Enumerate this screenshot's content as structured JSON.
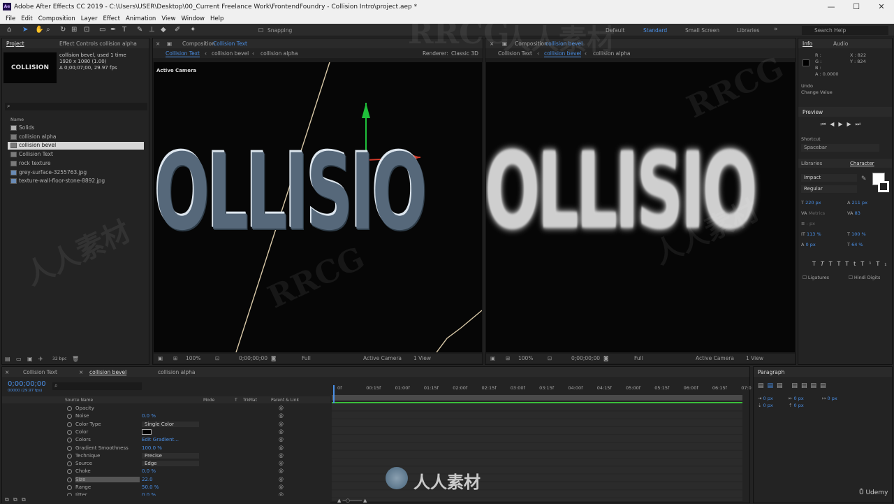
{
  "app": {
    "title": "Adobe After Effects CC 2019 - C:\\Users\\USER\\Desktop\\00_Current Freelance Work\\FrontendFoundry - Collision Intro\\project.aep *",
    "icon": "Ae"
  },
  "menu": [
    "File",
    "Edit",
    "Composition",
    "Layer",
    "Effect",
    "Animation",
    "View",
    "Window",
    "Help"
  ],
  "toolbar": {
    "snapping": "Snapping",
    "workspaces": [
      "Default",
      "Standard",
      "Small Screen",
      "Libraries"
    ],
    "search_placeholder": "Search Help"
  },
  "project": {
    "tab": "Project",
    "effect_tab": "Effect Controls collision alpha",
    "thumb_label": "COLLISION",
    "item_name": "collision bevel",
    "used": ", used 1 time",
    "dims": "1920 x 1080 (1.00)",
    "duration": "Δ 0;00;07;00, 29.97 fps",
    "col_name": "Name",
    "items": [
      {
        "name": "Solids",
        "type": "folder"
      },
      {
        "name": "collision alpha",
        "type": "comp"
      },
      {
        "name": "collision bevel",
        "type": "comp",
        "selected": true
      },
      {
        "name": "Collision Text",
        "type": "comp"
      },
      {
        "name": "rock texture",
        "type": "comp"
      },
      {
        "name": "grey-surface-3255763.jpg",
        "type": "image"
      },
      {
        "name": "texture-wall-floor-stone-8892.jpg",
        "type": "image"
      }
    ],
    "bpc": "32 bpc"
  },
  "comp1": {
    "tab_prefix": "Composition",
    "tab_name": "Collision Text",
    "crumbs": [
      "Collision Text",
      "collision bevel",
      "collision alpha"
    ],
    "renderer_label": "Renderer:",
    "renderer": "Classic 3D",
    "camera_label": "Active Camera",
    "text": "OLLISIO",
    "zoom": "100%",
    "time": "0;00;00;00",
    "quality": "Full",
    "camera": "Active Camera",
    "views": "1 View"
  },
  "comp2": {
    "tab_prefix": "Composition",
    "tab_name": "collision bevel",
    "crumbs": [
      "Collision Text",
      "collision bevel",
      "collision alpha"
    ],
    "text": "OLLISIO",
    "zoom": "100%",
    "time": "0;00;00;00",
    "quality": "Full",
    "camera": "Active Camera",
    "views": "1 View"
  },
  "info": {
    "tab": "Info",
    "audio_tab": "Audio",
    "r": "R :",
    "g": "G :",
    "b": "B :",
    "a": "A : 0.0000",
    "x": "X : 822",
    "y": "Y : 824",
    "undo": "Undo",
    "undo_val": "Change Value"
  },
  "preview": {
    "tab": "Preview",
    "shortcut_label": "Shortcut",
    "shortcut": "Spacebar"
  },
  "character": {
    "libraries": "Libraries",
    "tab": "Character",
    "font": "Impact",
    "style": "Regular",
    "size": "220 px",
    "leading": "211 px",
    "kerning": "Metrics",
    "tracking": "83",
    "stroke": "- px",
    "vscale": "113 %",
    "hscale": "100 %",
    "baseline": "0 px",
    "tsume": "64 %",
    "ligatures": "Ligatures",
    "hindi": "Hindi Digits"
  },
  "timeline": {
    "tabs": [
      "Collision Text",
      "collision bevel",
      "collision alpha"
    ],
    "time": "0;00;00;00",
    "fps": "00000 (29.97 fps)",
    "headers": [
      "Source Name",
      "Mode",
      "T",
      "TrkMat",
      "Parent & Link"
    ],
    "ruler": [
      "0f",
      "00:15f",
      "01:00f",
      "01:15f",
      "02:00f",
      "02:15f",
      "03:00f",
      "03:15f",
      "04:00f",
      "04:15f",
      "05:00f",
      "05:15f",
      "06:00f",
      "06:15f",
      "07:0"
    ],
    "props": [
      {
        "name": "Opacity",
        "value": ""
      },
      {
        "name": "Noise",
        "value": "0.0 %"
      },
      {
        "name": "Color Type",
        "value": "Single Color",
        "dropdown": true
      },
      {
        "name": "Color",
        "value": ""
      },
      {
        "name": "Colors",
        "value": "Edit Gradient..."
      },
      {
        "name": "Gradient Smoothness",
        "value": "100.0 %"
      },
      {
        "name": "Technique",
        "value": "Precise",
        "dropdown": true
      },
      {
        "name": "Source",
        "value": "Edge",
        "dropdown": true
      },
      {
        "name": "Choke",
        "value": "0.0 %"
      },
      {
        "name": "Size",
        "value": "22.0",
        "selected": true
      },
      {
        "name": "Range",
        "value": "50.0 %"
      },
      {
        "name": "Jitter",
        "value": "0.0 %"
      }
    ]
  },
  "paragraph": {
    "tab": "Paragraph",
    "indent1": "0 px",
    "indent2": "0 px",
    "indent3": "0 px",
    "space1": "0 px",
    "space2": "0 px"
  },
  "watermarks": [
    "RRCG",
    "人人素材",
    "RRCG",
    "人人素材",
    "RRCG",
    "人人素材"
  ],
  "brand": {
    "logo_text": "人人素材",
    "udemy": "Udemy"
  }
}
